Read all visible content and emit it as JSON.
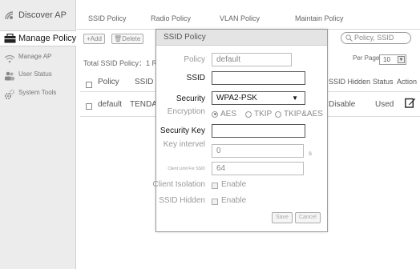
{
  "sidebar": {
    "items": [
      {
        "label": "Discover AP",
        "icon": "discover-icon"
      },
      {
        "label": "Manage Policy",
        "icon": "policy-icon",
        "active": true
      },
      {
        "label": "Manage AP",
        "icon": "wifi-icon"
      },
      {
        "label": "User Status",
        "icon": "users-icon"
      },
      {
        "label": "System Tools",
        "icon": "gear-icon"
      }
    ]
  },
  "tabs": [
    "SSID Policy",
    "Radio Policy",
    "VLAN Policy",
    "Maintain Policy"
  ],
  "toolbar": {
    "add_label": "+Add",
    "delete_label": "Delete",
    "search_placeholder": "Policy, SSID"
  },
  "summary": {
    "total_label": "Total SSID Policy：1 R",
    "per_page_label": "Per Page",
    "per_page_value": "10"
  },
  "table": {
    "headers": [
      "Policy",
      "SSID",
      "SSID Hidden",
      "Status",
      "Action"
    ],
    "rows": [
      {
        "policy": "default",
        "ssid": "TENDA_",
        "hidden": "Disable",
        "status": "Used"
      }
    ]
  },
  "dialog": {
    "title": "SSID Policy",
    "policy_label": "Policy",
    "policy_value": "default",
    "ssid_label": "SSID",
    "ssid_value": "",
    "security_label": "Security",
    "security_value": "WPA2-PSK",
    "encryption_label": "Encryption",
    "encryption_options": [
      "AES",
      "TKIP",
      "TKIP&AES"
    ],
    "encryption_selected": "AES",
    "security_key_label": "Security Key",
    "security_key_value": "",
    "key_interval_label": "Key intervel",
    "key_interval_value": "0",
    "key_interval_unit": "s",
    "client_limit_label": "Client Limit For SSID",
    "client_limit_value": "64",
    "client_isolation_label": "Client Isolation",
    "client_isolation_option": "Enable",
    "ssid_hidden_label": "SSID Hidden",
    "ssid_hidden_option": "Enable",
    "save_label": "Save",
    "cancel_label": "Cancel"
  },
  "colors": {
    "sidebar_bg": "#ececec",
    "dialog_header_bg": "#e4e4e4",
    "border": "#9a9a9a"
  }
}
